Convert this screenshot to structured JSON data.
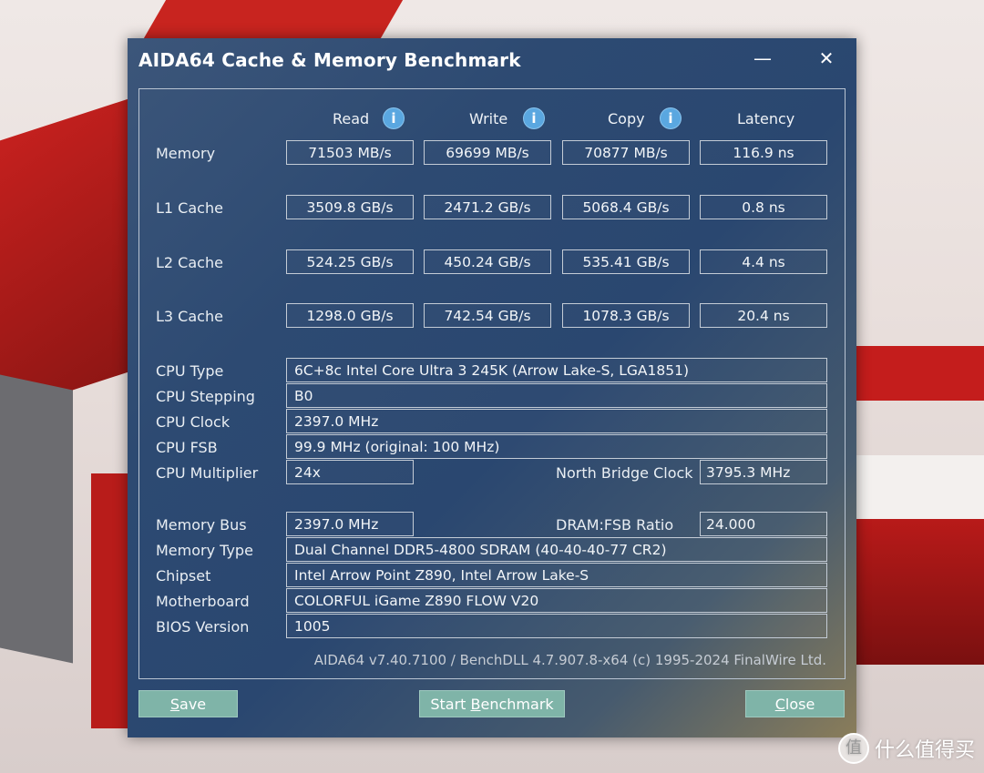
{
  "window": {
    "title": "AIDA64 Cache & Memory Benchmark",
    "minimize_glyph": "—",
    "close_glyph": "✕"
  },
  "columns": {
    "read": "Read",
    "write": "Write",
    "copy": "Copy",
    "latency": "Latency",
    "info_glyph": "i"
  },
  "results": [
    {
      "label": "Memory",
      "read": "71503 MB/s",
      "write": "69699 MB/s",
      "copy": "70877 MB/s",
      "latency": "116.9 ns"
    },
    {
      "label": "L1 Cache",
      "read": "3509.8 GB/s",
      "write": "2471.2 GB/s",
      "copy": "5068.4 GB/s",
      "latency": "0.8 ns"
    },
    {
      "label": "L2 Cache",
      "read": "524.25 GB/s",
      "write": "450.24 GB/s",
      "copy": "535.41 GB/s",
      "latency": "4.4 ns"
    },
    {
      "label": "L3 Cache",
      "read": "1298.0 GB/s",
      "write": "742.54 GB/s",
      "copy": "1078.3 GB/s",
      "latency": "20.4 ns"
    }
  ],
  "cpu": {
    "type_label": "CPU Type",
    "type_value": "6C+8c Intel Core Ultra 3 245K  (Arrow Lake-S, LGA1851)",
    "stepping_label": "CPU Stepping",
    "stepping_value": "B0",
    "clock_label": "CPU Clock",
    "clock_value": "2397.0 MHz",
    "fsb_label": "CPU FSB",
    "fsb_value": "99.9 MHz  (original: 100 MHz)",
    "multiplier_label": "CPU Multiplier",
    "multiplier_value": "24x",
    "nb_clock_label": "North Bridge Clock",
    "nb_clock_value": "3795.3 MHz"
  },
  "memory": {
    "bus_label": "Memory Bus",
    "bus_value": "2397.0 MHz",
    "ratio_label": "DRAM:FSB Ratio",
    "ratio_value": "24.000",
    "type_label": "Memory Type",
    "type_value": "Dual Channel DDR5-4800 SDRAM  (40-40-40-77 CR2)",
    "chipset_label": "Chipset",
    "chipset_value": "Intel Arrow Point Z890, Intel Arrow Lake-S",
    "motherboard_label": "Motherboard",
    "motherboard_value": "COLORFUL iGame Z890 FLOW V20",
    "bios_label": "BIOS Version",
    "bios_value": "1005"
  },
  "footer": "AIDA64 v7.40.7100 / BenchDLL 4.7.907.8-x64  (c) 1995-2024 FinalWire Ltd.",
  "buttons": {
    "save_a": "S",
    "save_b": "ave",
    "start_a": "Start ",
    "start_b": "B",
    "start_c": "enchmark",
    "close_a": "C",
    "close_b": "lose"
  },
  "watermark": {
    "logo": "值",
    "text": "什么值得买"
  }
}
